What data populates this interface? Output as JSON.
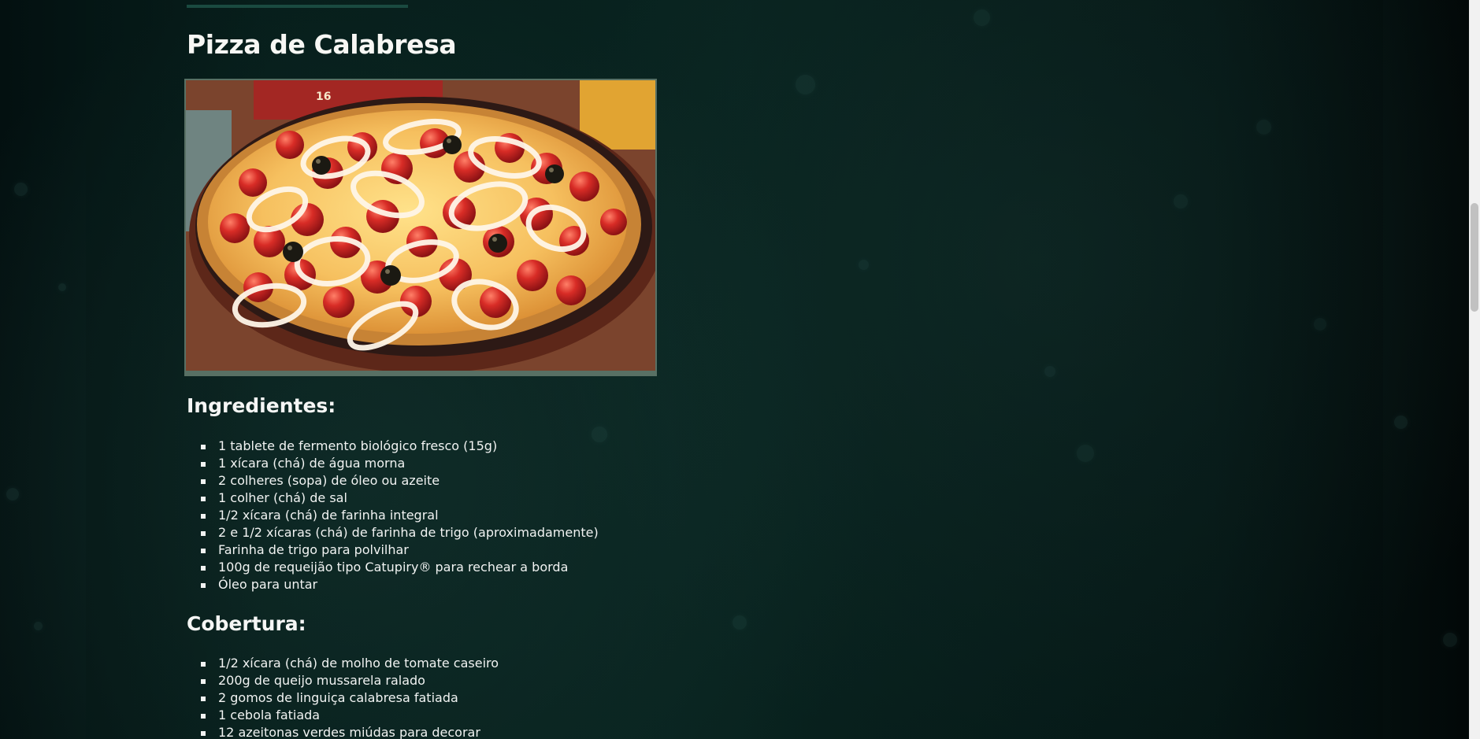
{
  "recipe": {
    "title": "Pizza de Calabresa",
    "image_alt": "Pizza de calabresa"
  },
  "ingredients": {
    "heading": "Ingredientes:",
    "items": [
      "1 tablete de fermento biológico fresco (15g)",
      "1 xícara (chá) de água morna",
      "2 colheres (sopa) de óleo ou azeite",
      "1 colher (chá) de sal",
      "1/2 xícara (chá) de farinha integral",
      "2 e 1/2 xícaras (chá) de farinha de trigo (aproximadamente)",
      "Farinha de trigo para polvilhar",
      "100g de requeijão tipo Catupiry® para rechear a borda",
      "Óleo para untar"
    ]
  },
  "topping": {
    "heading": "Cobertura:",
    "items": [
      "1/2 xícara (chá) de molho de tomate caseiro",
      "200g de queijo mussarela ralado",
      "2 gomos de linguiça calabresa fatiada",
      "1 cebola fatiada",
      "12 azeitonas verdes miúdas para decorar"
    ]
  },
  "colors": {
    "background": "#08231f",
    "accent": "#1a4a40",
    "text": "#f2f5f4",
    "image_border": "#587064"
  }
}
